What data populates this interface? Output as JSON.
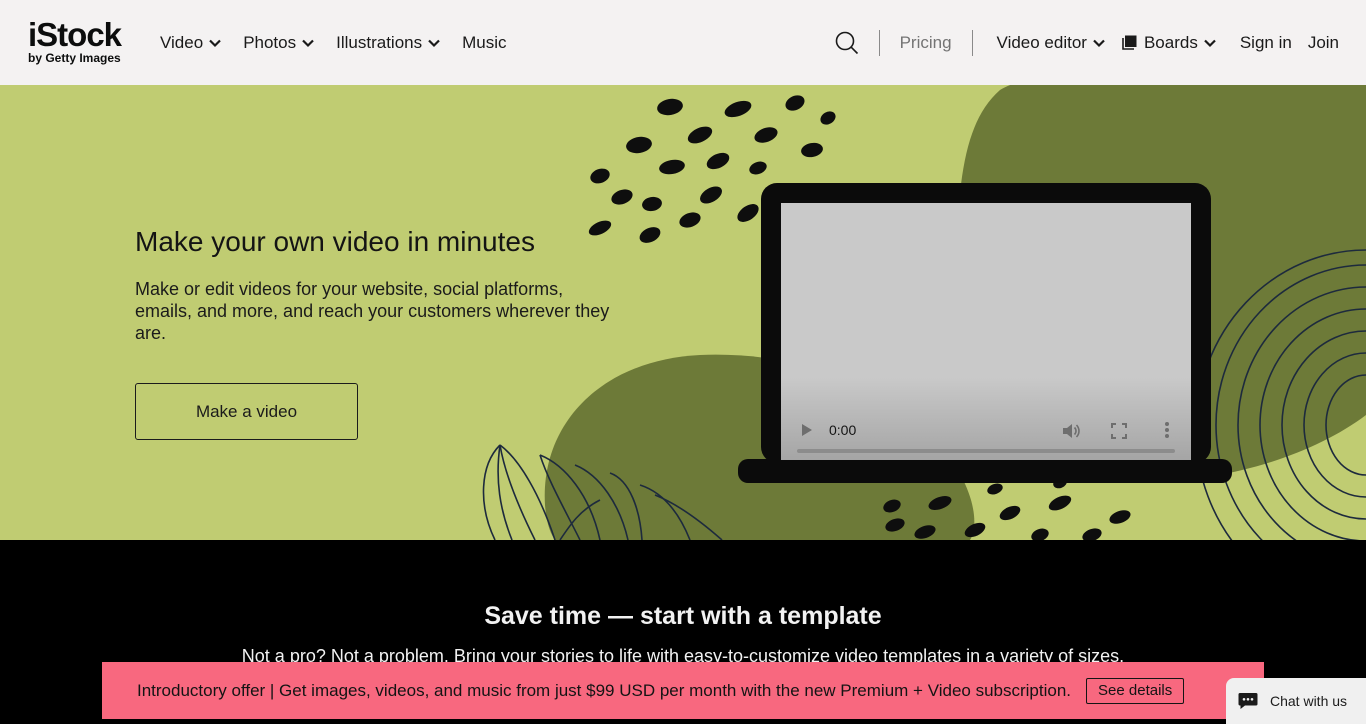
{
  "header": {
    "logo_main": "iStock",
    "logo_sub": "by Getty Images",
    "nav_left": [
      {
        "label": "Video",
        "has_dropdown": true
      },
      {
        "label": "Photos",
        "has_dropdown": true
      },
      {
        "label": "Illustrations",
        "has_dropdown": true
      },
      {
        "label": "Music",
        "has_dropdown": false
      }
    ],
    "search_icon": "search-icon",
    "pricing": "Pricing",
    "video_editor": "Video editor",
    "boards": "Boards",
    "boards_icon": "boards-icon",
    "sign_in": "Sign in",
    "join": "Join"
  },
  "hero": {
    "title": "Make your own video in minutes",
    "description": "Make or edit videos for your website, social platforms, emails, and more, and reach your customers wherever they are.",
    "cta": "Make a video",
    "video": {
      "time": "0:00",
      "progress": 0,
      "icons": [
        "play-icon",
        "volume-icon",
        "fullscreen-icon",
        "more-icon"
      ]
    }
  },
  "templates": {
    "title": "Save time — start with a template",
    "subtitle": "Not a pro? Not a problem. Bring your stories to life with easy-to-customize video templates in a variety of sizes."
  },
  "promo": {
    "text": "Introductory offer | Get images, videos, and music from just $99 USD per month with the new Premium + Video subscription.",
    "button": "See details"
  },
  "chat": {
    "label": "Chat with us",
    "icon": "chat-bubble-icon"
  },
  "colors": {
    "header_bg": "#f4f2f2",
    "hero_bg": "#c0cc72",
    "hero_dark_blob": "#6d7a38",
    "promo_bg": "#f8687f",
    "template_bg": "#000000"
  }
}
